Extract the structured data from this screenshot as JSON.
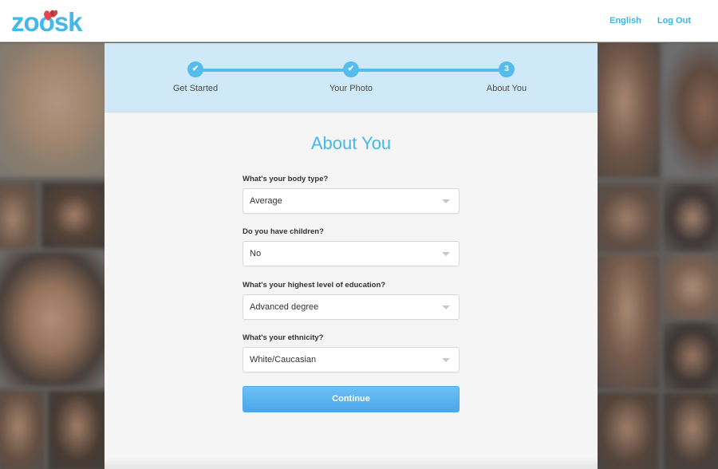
{
  "header": {
    "logo": {
      "text": "zoösk",
      "name": "zoosk"
    },
    "links": [
      {
        "label": "English"
      },
      {
        "label": "Log Out"
      }
    ]
  },
  "progress": {
    "steps": [
      {
        "label": "Get Started",
        "status": "complete",
        "icon": "check-icon",
        "marker": "✔"
      },
      {
        "label": "Your Photo",
        "status": "complete",
        "icon": "check-icon",
        "marker": "✔"
      },
      {
        "label": "About You",
        "status": "current",
        "marker": "3"
      }
    ]
  },
  "form": {
    "title": "About You",
    "fields": [
      {
        "label": "What's your body type?",
        "value": "Average"
      },
      {
        "label": "Do you have children?",
        "value": "No"
      },
      {
        "label": "What's your highest level of education?",
        "value": "Advanced degree"
      },
      {
        "label": "What's your ethnicity?",
        "value": "White/Caucasian"
      }
    ],
    "submit_label": "Continue"
  },
  "colors": {
    "brand": "#45b8ea",
    "progress_bg": "#cfe9f8",
    "button": "#5ab3ee"
  }
}
